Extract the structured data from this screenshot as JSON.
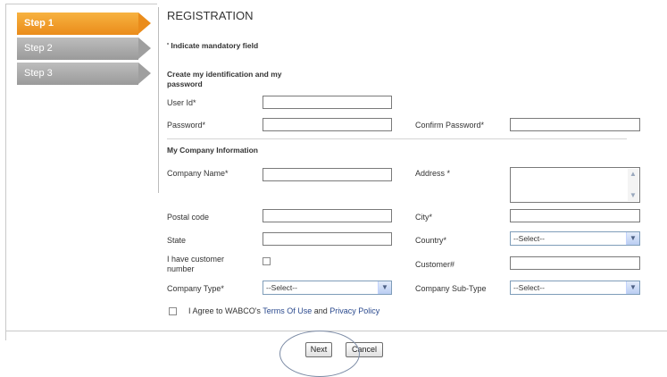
{
  "steps": [
    {
      "label": "Step 1",
      "state": "active"
    },
    {
      "label": "Step 2",
      "state": "inactive"
    },
    {
      "label": "Step 3",
      "state": "inactive"
    }
  ],
  "form": {
    "title": "REGISTRATION",
    "mandatory_note": "' Indicate mandatory field",
    "section_identification": "Create my identification and my password",
    "section_company": "My Company Information",
    "fields": {
      "user_id": {
        "label": "User Id*",
        "value": ""
      },
      "password": {
        "label": "Password*",
        "value": ""
      },
      "confirm_password": {
        "label": "Confirm Password*",
        "value": ""
      },
      "company_name": {
        "label": "Company Name*",
        "value": ""
      },
      "address": {
        "label": "Address *",
        "value": ""
      },
      "postal_code": {
        "label": "Postal code",
        "value": ""
      },
      "city": {
        "label": "City*",
        "value": ""
      },
      "state": {
        "label": "State",
        "value": ""
      },
      "country": {
        "label": "Country*",
        "selected": "--Select--"
      },
      "customer_number_check": {
        "label": "I have customer number",
        "checked": false
      },
      "customer_no": {
        "label": "Customer#",
        "value": ""
      },
      "company_type": {
        "label": "Company Type*",
        "selected": "--Select--"
      },
      "company_sub_type": {
        "label": "Company Sub-Type",
        "selected": "--Select--"
      }
    },
    "agree": {
      "prefix": "I Agree to WABCO's ",
      "terms_link": "Terms Of Use",
      "and": " and ",
      "privacy_link": "Privacy Policy",
      "checked": false
    }
  },
  "buttons": {
    "next": "Next",
    "cancel": "Cancel"
  },
  "colors": {
    "active_step": "#EA8C1B",
    "inactive_step": "#A6A6A6",
    "link": "#2B4A8E",
    "annotation": "#7D8CA6"
  },
  "icons": [
    "chevron-down-icon",
    "scroll-up-icon",
    "scroll-down-icon"
  ]
}
